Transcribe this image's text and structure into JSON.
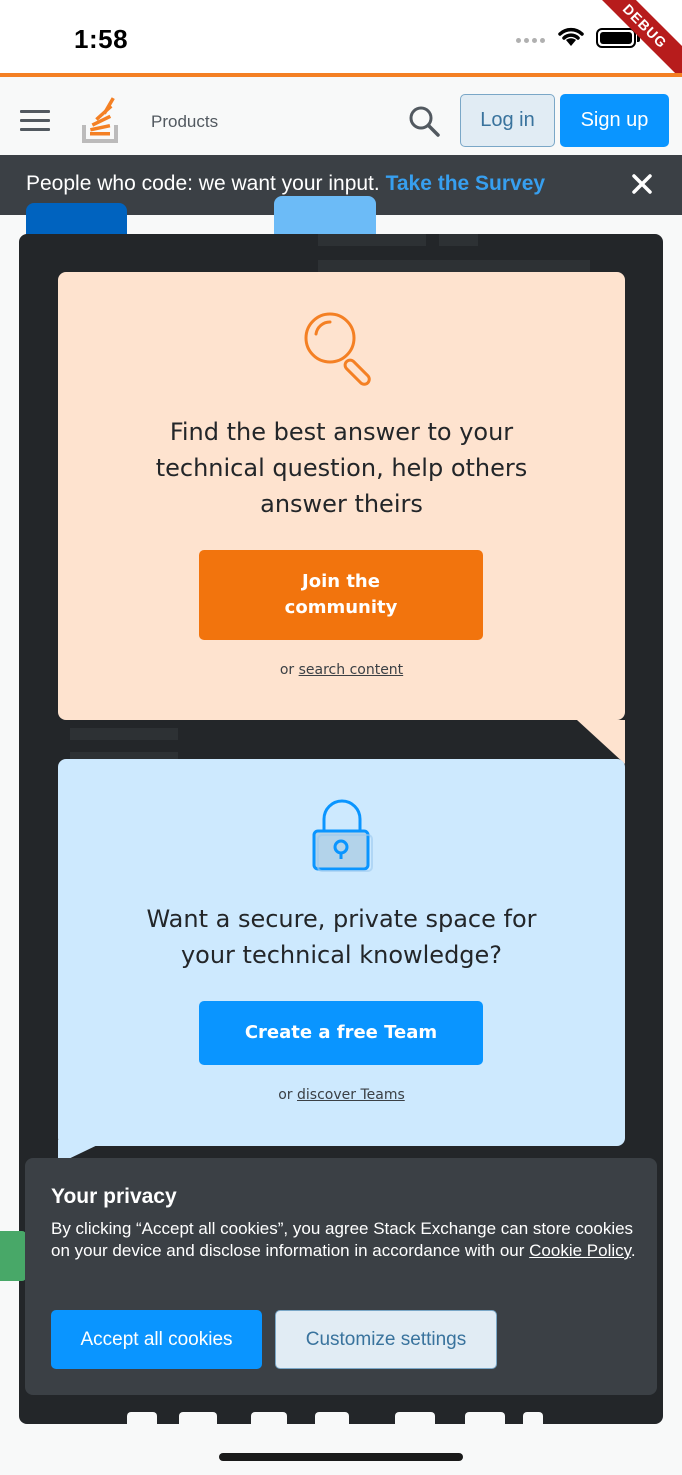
{
  "status_bar": {
    "time": "1:58",
    "debug_label": "DEBUG"
  },
  "topbar": {
    "products_label": "Products",
    "login_label": "Log in",
    "signup_label": "Sign up"
  },
  "survey_banner": {
    "text": "People who code: we want your input. ",
    "link_label": "Take the Survey"
  },
  "community_card": {
    "heading_lines": [
      "Find the best answer to your",
      "technical question, help others",
      "answer theirs"
    ],
    "button_lines": [
      "Join the",
      "community"
    ],
    "alt_prefix": "or ",
    "alt_link": "search content"
  },
  "teams_card": {
    "heading_lines": [
      "Want a secure, private space for",
      "your technical knowledge?"
    ],
    "button_label": "Create a free Team",
    "alt_prefix": "or ",
    "alt_link": "discover Teams"
  },
  "privacy": {
    "title": "Your privacy",
    "body": "By clicking “Accept all cookies”, you agree Stack Exchange can store cookies on your device and disclose information in accordance with our ",
    "policy_link": "Cookie Policy",
    "body_end": ".",
    "accept_label": "Accept all cookies",
    "customize_label": "Customize settings"
  },
  "colors": {
    "accent_orange": "#f48024",
    "brand_blue": "#0a95ff",
    "survey_link": "#379fef",
    "orange_card": "#fee3cf",
    "blue_card": "#cde9fe"
  }
}
